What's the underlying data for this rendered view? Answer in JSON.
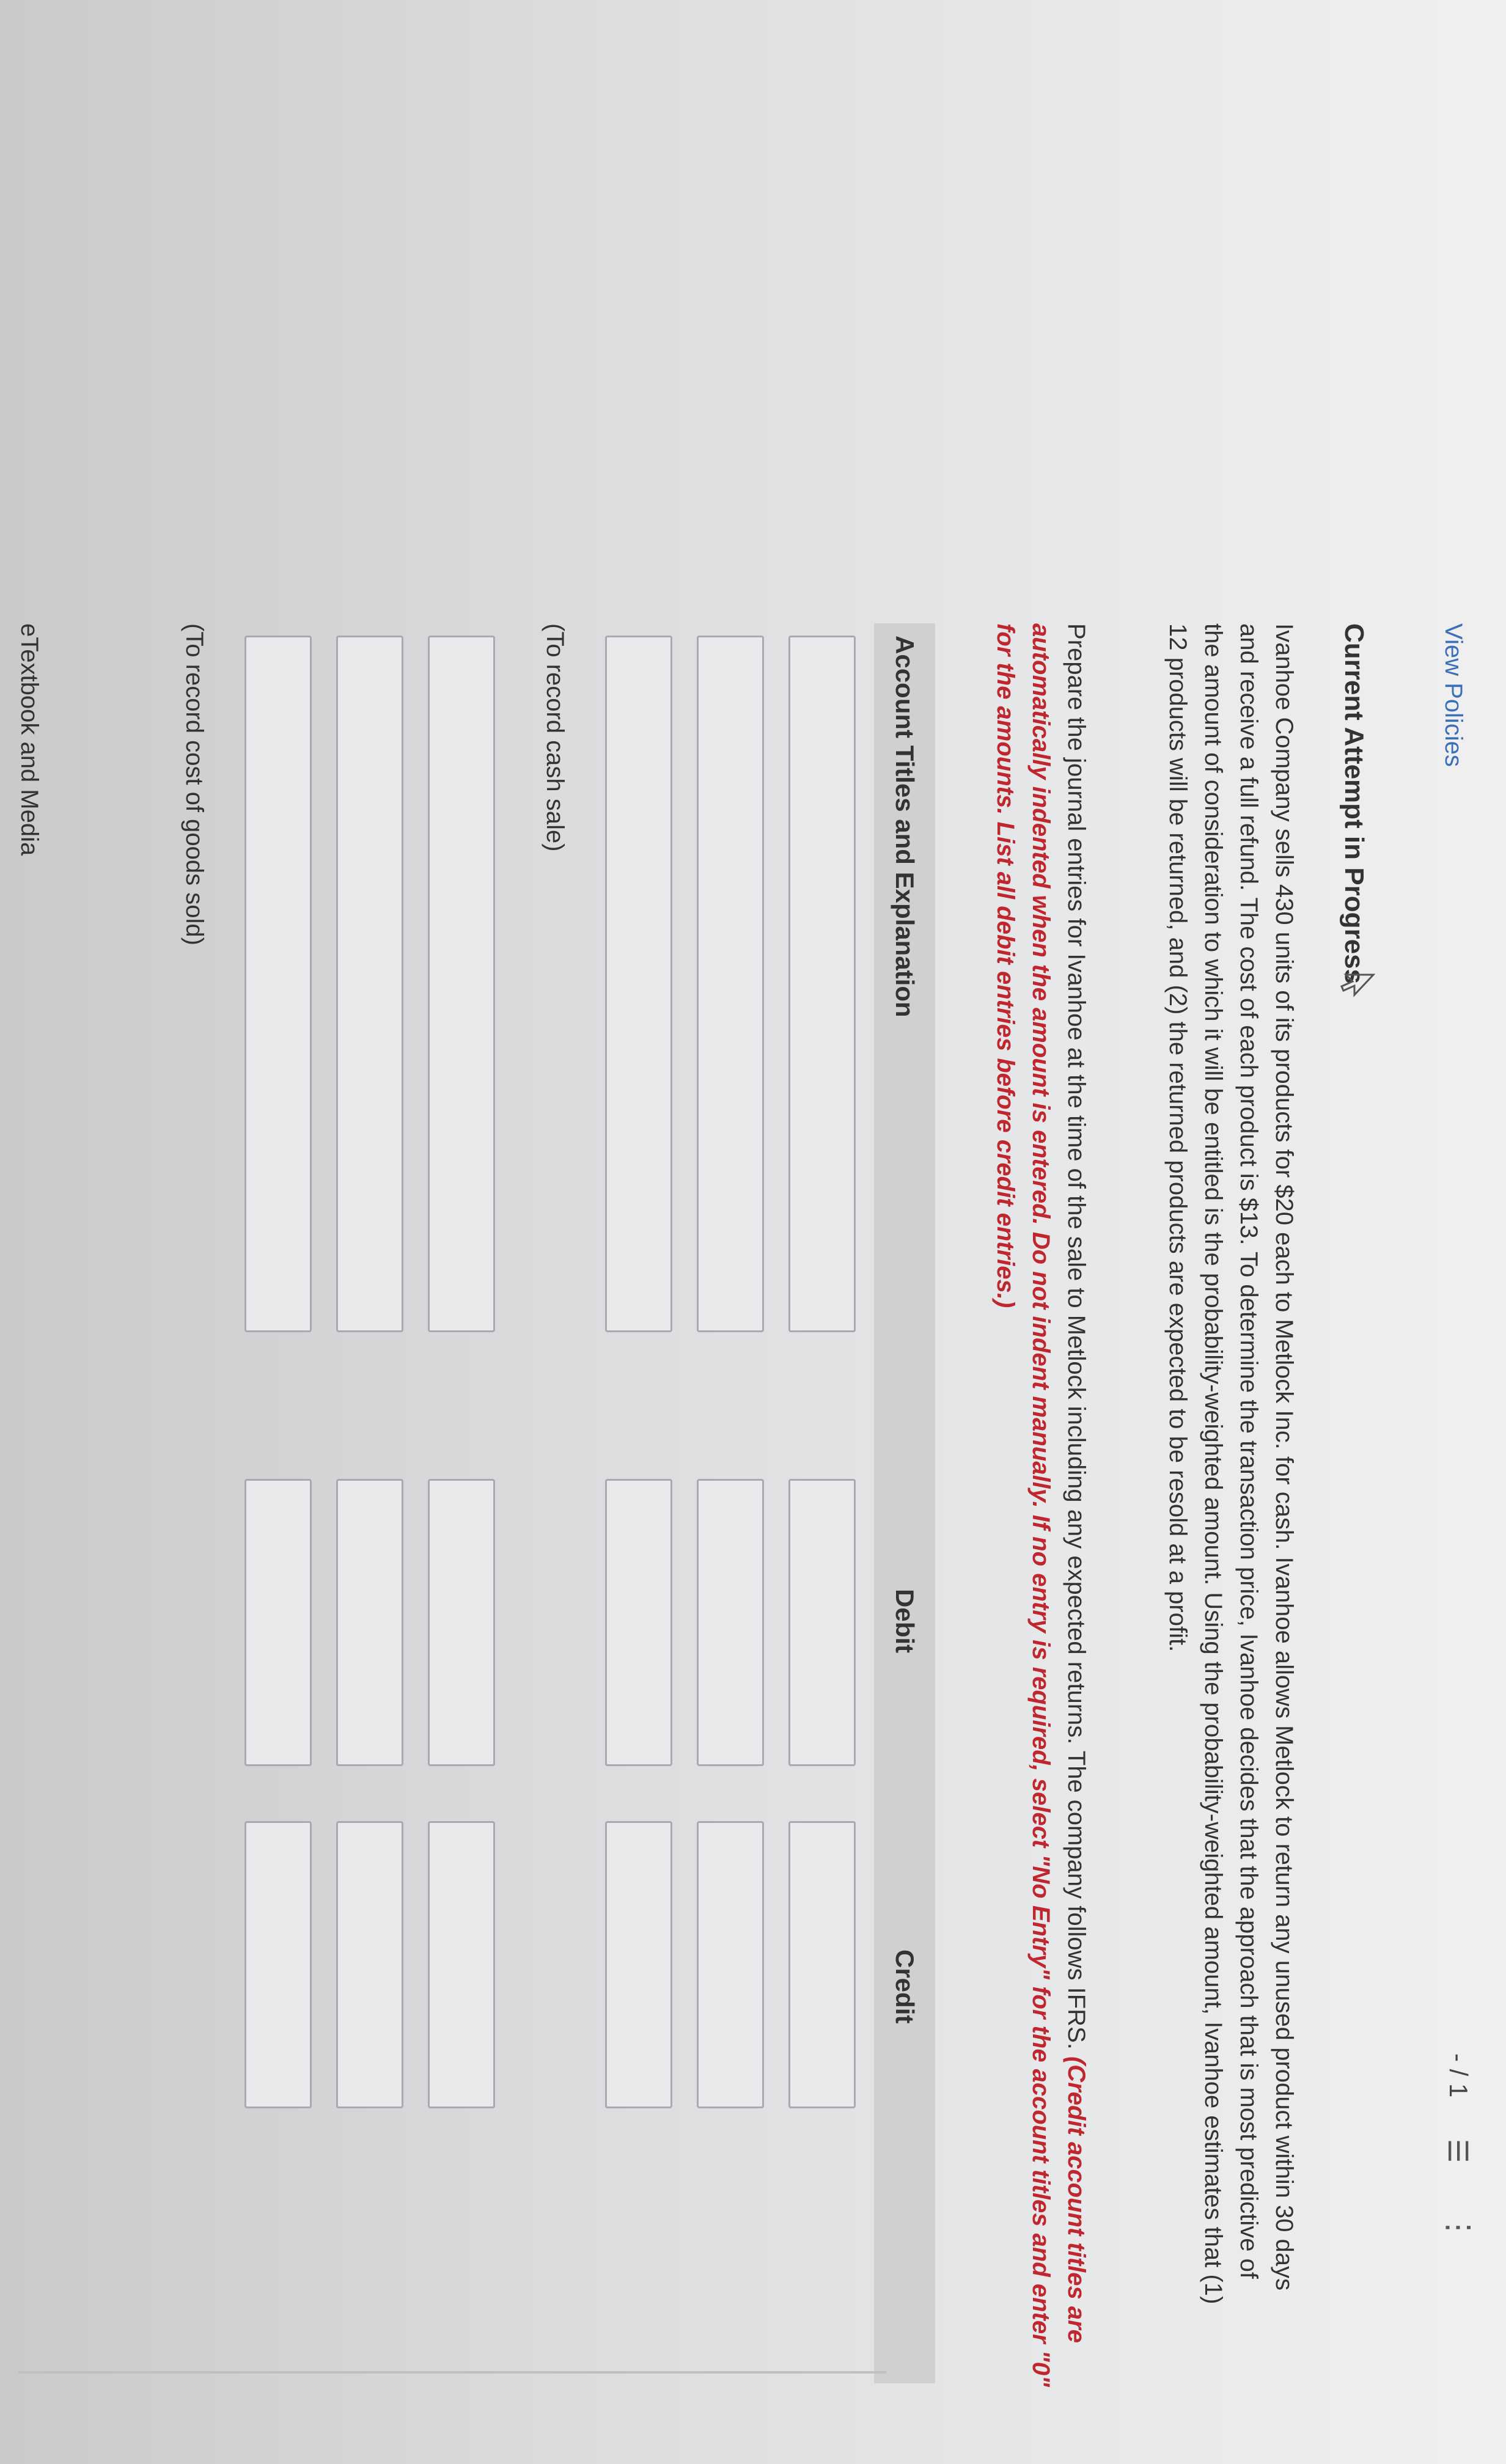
{
  "header": {
    "view_policies": "View Policies",
    "pager": "- / 1",
    "list_icon": "list-icon",
    "more_icon": "more-options-icon"
  },
  "attempt_title": "Current Attempt in Progress",
  "problem_text": "Ivanhoe Company sells 430 units of its products for $20 each to Metlock Inc. for cash. Ivanhoe allows Metlock to return any unused product within 30 days and receive a full refund. The cost of each product is $13. To determine the transaction price, Ivanhoe decides that the approach that is most predictive of the amount of consideration to which it will be entitled is the probability-weighted amount. Using the probability-weighted amount, Ivanhoe estimates that (1) 12 products will be returned, and (2) the returned products are expected to be resold at a profit.",
  "instructions": {
    "main": "Prepare the journal entries for Ivanhoe at the time of the sale to Metlock including any expected returns. The company follows IFRS.",
    "red1": "(Credit account titles are automatically indented when the amount is entered. Do not indent manually. If no entry is required, select \"No Entry\" for the account titles and enter \"0\" for the amounts. List all debit entries before credit entries.)"
  },
  "table": {
    "col_account": "Account Titles and Explanation",
    "col_debit": "Debit",
    "col_credit": "Credit",
    "entry1_caption": "(To record cash sale)",
    "entry2_caption": "(To record cost of goods sold)",
    "entry1_rows": [
      {
        "account": "",
        "debit": "",
        "credit": ""
      },
      {
        "account": "",
        "debit": "",
        "credit": ""
      },
      {
        "account": "",
        "debit": "",
        "credit": ""
      }
    ],
    "entry2_rows": [
      {
        "account": "",
        "debit": "",
        "credit": ""
      },
      {
        "account": "",
        "debit": "",
        "credit": ""
      },
      {
        "account": "",
        "debit": "",
        "credit": ""
      }
    ]
  },
  "footer": "eTextbook and Media"
}
